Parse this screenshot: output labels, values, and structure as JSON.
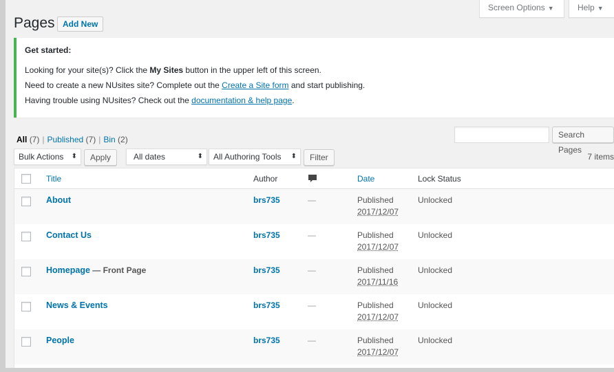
{
  "screen_meta": {
    "screen_options": "Screen Options",
    "help": "Help"
  },
  "header": {
    "title": "Pages",
    "add_new": "Add New"
  },
  "notice": {
    "heading": "Get started:",
    "line1": {
      "pre": "Looking for your site(s)? Click the ",
      "bold": "My Sites",
      "post": " button in the upper left of this screen."
    },
    "line2": {
      "pre": "Need to create a new NUsites site? Complete out the ",
      "link": "Create a Site form",
      "post": " and start publishing."
    },
    "line3": {
      "pre": "Having trouble using NUsites? Check out the ",
      "link": "documentation & help page",
      "post": "."
    }
  },
  "filters": {
    "all": "All",
    "all_count": "(7)",
    "published": "Published",
    "published_count": "(7)",
    "bin": "Bin",
    "bin_count": "(2)",
    "sep": "|"
  },
  "search": {
    "button": "Search Pages"
  },
  "toolbar": {
    "bulk_actions": "Bulk Actions",
    "apply": "Apply",
    "dates": "All dates",
    "authoring_tools": "All Authoring Tools",
    "filter": "Filter",
    "items_count": "7 items"
  },
  "table": {
    "columns": {
      "title": "Title",
      "author": "Author",
      "date": "Date",
      "lock_status": "Lock Status"
    },
    "rows": [
      {
        "title": "About",
        "state": "",
        "author": "brs735",
        "comments": "—",
        "status": "Published",
        "date": "2017/12/07",
        "lock": "Unlocked"
      },
      {
        "title": "Contact Us",
        "state": "",
        "author": "brs735",
        "comments": "—",
        "status": "Published",
        "date": "2017/12/07",
        "lock": "Unlocked"
      },
      {
        "title": "Homepage",
        "state": " — Front Page",
        "author": "brs735",
        "comments": "—",
        "status": "Published",
        "date": "2017/11/16",
        "lock": "Unlocked"
      },
      {
        "title": "News & Events",
        "state": "",
        "author": "brs735",
        "comments": "—",
        "status": "Published",
        "date": "2017/12/07",
        "lock": "Unlocked"
      },
      {
        "title": "People",
        "state": "",
        "author": "brs735",
        "comments": "—",
        "status": "Published",
        "date": "2017/12/07",
        "lock": "Unlocked"
      }
    ]
  },
  "colors": {
    "link": "#0073aa",
    "notice_accent": "#46b450",
    "background": "#f1f1f1"
  }
}
